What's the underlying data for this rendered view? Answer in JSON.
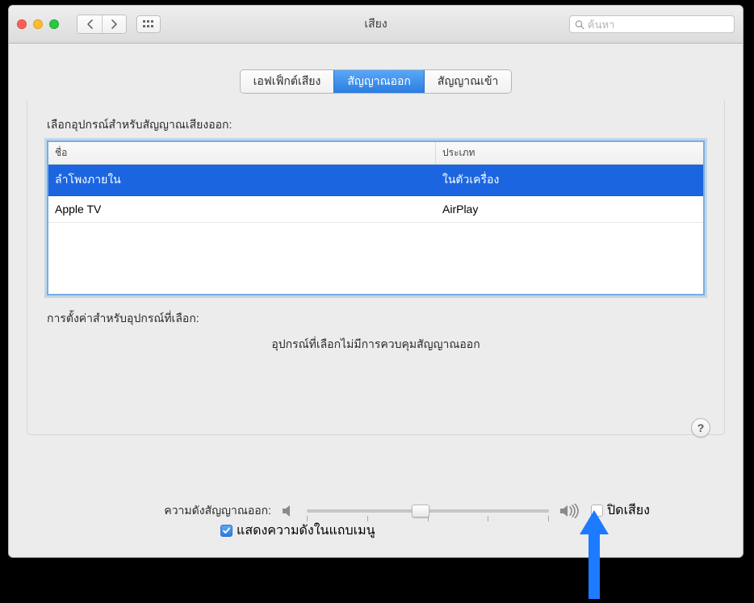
{
  "window": {
    "title": "เสียง",
    "search_placeholder": "ค้นหา"
  },
  "tabs": {
    "effects": "เอฟเฟ็กต์เสียง",
    "output": "สัญญาณออก",
    "input": "สัญญาณเข้า",
    "active": "output"
  },
  "output_section": {
    "select_label": "เลือกอุปกรณ์สำหรับสัญญาณเสียงออก:",
    "columns": {
      "name": "ชื่อ",
      "kind": "ประเภท"
    },
    "devices": [
      {
        "name": "ลำโพงภายใน",
        "kind": "ในตัวเครื่อง",
        "selected": true
      },
      {
        "name": "Apple TV",
        "kind": "AirPlay",
        "selected": false
      }
    ],
    "settings_label": "การตั้งค่าสำหรับอุปกรณ์ที่เลือก:",
    "no_controls": "อุปกรณ์ที่เลือกไม่มีการควบคุมสัญญาณออก"
  },
  "footer": {
    "volume_label": "ความดังสัญญาณออก:",
    "volume_percent": 47,
    "mute_label": "ปิดเสียง",
    "mute_checked": false,
    "show_menubar_label": "แสดงความดังในแถบเมนู",
    "show_menubar_checked": true
  },
  "help_label": "?"
}
